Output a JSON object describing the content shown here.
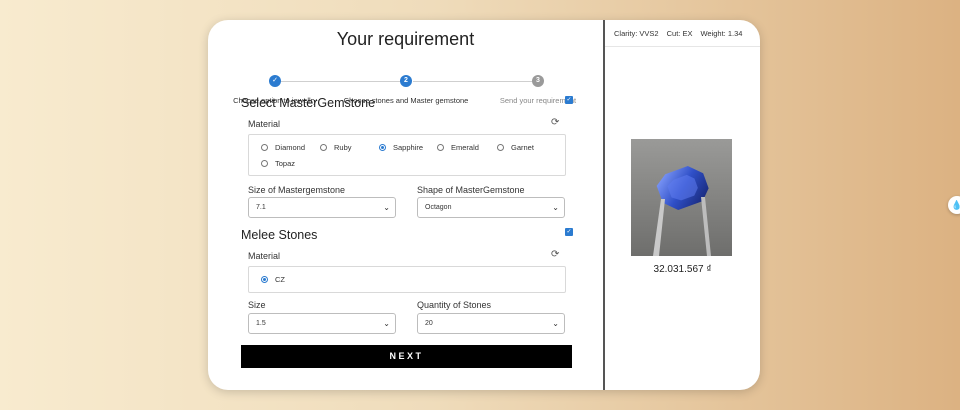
{
  "title": "Your requirement",
  "steps": [
    {
      "number": "1",
      "label": "Choose option to jewellry",
      "state": "done"
    },
    {
      "number": "2",
      "label": "Choose stones and Master gemstone",
      "state": "active"
    },
    {
      "number": "3",
      "label": "Send your requirement",
      "state": "pending"
    }
  ],
  "master": {
    "title": "Select MasterGemstone",
    "checked": true,
    "material_label": "Material",
    "materials": [
      "Diamond",
      "Ruby",
      "Sapphire",
      "Emerald",
      "Garnet",
      "Topaz"
    ],
    "selected_material": "Sapphire",
    "size_label": "Size of Mastergemstone",
    "size_value": "7.1",
    "shape_label": "Shape of MasterGemstone",
    "shape_value": "Octagon"
  },
  "melee": {
    "title": "Melee Stones",
    "checked": true,
    "material_label": "Material",
    "materials": [
      "CZ"
    ],
    "selected_material": "CZ",
    "size_label": "Size",
    "size_value": "1.5",
    "quantity_label": "Quantity of Stones",
    "quantity_value": "20"
  },
  "next_label": "NEXT",
  "product": {
    "clarity": "Clarity: VVS2",
    "cut": "Cut: EX",
    "weight": "Weight: 1.34",
    "price": "32.031.567 ₫"
  },
  "colors": {
    "accent": "#2b7bd0",
    "button": "#000000"
  }
}
